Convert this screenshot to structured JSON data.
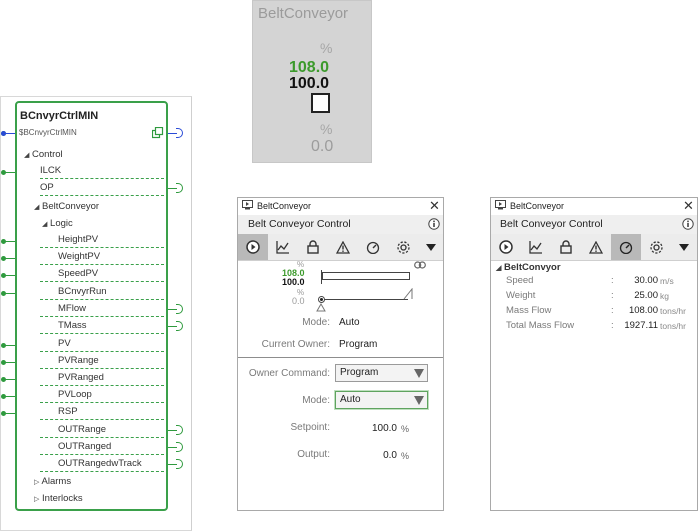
{
  "function_block": {
    "name": "BCnvyrCtrlMIN",
    "instance": "$BCnvyrCtrlMIN",
    "groups": {
      "control": "Control",
      "belt_conveyor": "BeltConveyor",
      "logic": "Logic",
      "alarms": "Alarms",
      "interlocks": "Interlocks"
    },
    "pins": {
      "ilck": "ILCK",
      "op": "OP",
      "height_pv": "HeightPV",
      "weight_pv": "WeightPV",
      "speed_pv": "SpeedPV",
      "bcnvyr_run": "BCnvyrRun",
      "mflow": "MFlow",
      "tmass": "TMass",
      "pv": "PV",
      "pv_range": "PVRange",
      "pv_ranged": "PVRanged",
      "pv_loop": "PVLoop",
      "rsp": "RSP",
      "out_range": "OUTRange",
      "out_ranged": "OUTRanged",
      "out_ranged_w_track": "OUTRangedwTrack"
    }
  },
  "summary": {
    "title": "BeltConveyor",
    "pct_top": "%",
    "pv_value": "108.0",
    "sp_value": "100.0",
    "pct_bottom": "%",
    "out_value": "0.0",
    "colors": {
      "pv": "#3c9a2c",
      "sp": "#111111",
      "out": "#9c9c9c"
    }
  },
  "control_window": {
    "title": "BeltConveyor",
    "header": "Belt Conveyor Control",
    "tabs": [
      "play-icon",
      "trend-icon",
      "lock-icon",
      "alarm-icon",
      "gauge-icon",
      "gear-icon",
      "dropdown-arrow-icon"
    ],
    "bars": {
      "pct_top": "%",
      "pv": "108.0",
      "sp": "100.0",
      "pct_bottom": "%",
      "out": "0.0"
    },
    "mode_label": "Mode:",
    "mode_value": "Auto",
    "owner_label": "Current Owner:",
    "owner_value": "Program",
    "owner_command_label": "Owner Command:",
    "owner_command_value": "Program",
    "mode_select_label": "Mode:",
    "mode_select_value": "Auto",
    "setpoint_label": "Setpoint:",
    "setpoint_value": "100.0",
    "setpoint_unit": "%",
    "output_label": "Output:",
    "output_value": "0.0",
    "output_unit": "%"
  },
  "detail_window": {
    "title": "BeltConveyor",
    "header": "Belt Conveyor Control",
    "section": "BeltConvyor",
    "rows": [
      {
        "label": "Speed",
        "value": "30.00",
        "unit": "m/s"
      },
      {
        "label": "Weight",
        "value": "25.00",
        "unit": "kg"
      },
      {
        "label": "Mass Flow",
        "value": "108.00",
        "unit": "tons/hr"
      },
      {
        "label": "Total Mass Flow",
        "value": "1927.11",
        "unit": "tons/hr"
      }
    ]
  }
}
